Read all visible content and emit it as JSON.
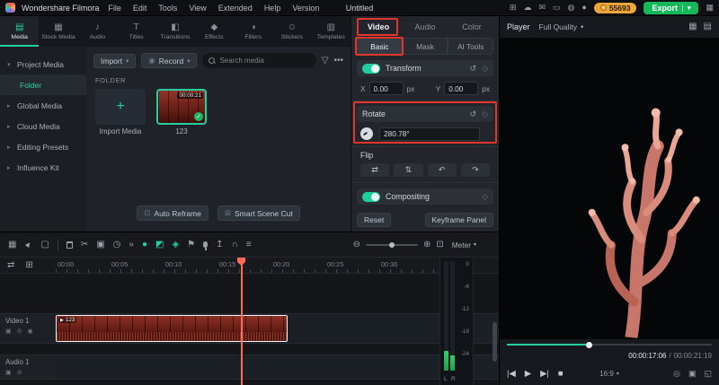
{
  "menubar": {
    "app_name": "Wondershare Filmora",
    "menus": [
      "File",
      "Edit",
      "Tools",
      "View",
      "Extended",
      "Help",
      "Version"
    ],
    "project_title": "Untitled",
    "credits": "55693",
    "export_label": "Export"
  },
  "media_tabs": {
    "labels": [
      "Media",
      "Stock Media",
      "Audio",
      "Titles",
      "Transitions",
      "Effects",
      "Filters",
      "Stickers",
      "Templates"
    ],
    "icons": [
      "▤",
      "▦",
      "♪",
      "T",
      "◧",
      "◆",
      "◑",
      "☺",
      "▥"
    ]
  },
  "sidebar": {
    "items": [
      "Project Media",
      "Folder",
      "Global Media",
      "Cloud Media",
      "Editing Presets",
      "Influence Kit"
    ]
  },
  "media_panel": {
    "import_label": "Import",
    "record_label": "Record",
    "search_placeholder": "Search media",
    "folder_heading": "FOLDER",
    "import_tile_label": "Import Media",
    "clip_name": "123",
    "clip_duration": "00:00:21",
    "auto_reframe_label": "Auto Reframe",
    "smart_scene_cut_label": "Smart Scene Cut"
  },
  "properties": {
    "tabs": [
      "Video",
      "Audio",
      "Color"
    ],
    "subtabs": [
      "Basic",
      "Mask",
      "AI Tools"
    ],
    "transform_label": "Transform",
    "x_label": "X",
    "x_value": "0.00",
    "x_unit": "px",
    "y_label": "Y",
    "y_value": "0.00",
    "y_unit": "px",
    "rotate_label": "Rotate",
    "rotate_value": "280.78°",
    "flip_label": "Flip",
    "compositing_label": "Compositing",
    "reset_label": "Reset",
    "keyframe_panel_label": "Keyframe Panel"
  },
  "player": {
    "label": "Player",
    "quality": "Full Quality",
    "current_time": "00:00:17:06",
    "time_separator": "/",
    "total_time": "00:00:21:19",
    "ratio": "16:9",
    "progress_percent": 40
  },
  "timeline": {
    "ruler": [
      "00:00",
      "00:05",
      "00:10",
      "00:15",
      "00:20",
      "00:25",
      "00:30"
    ],
    "video_track_name": "Video 1",
    "audio_track_name": "Audio 1",
    "clip_label": "123",
    "meter_label": "Meter",
    "meter_scale": [
      "0",
      "-6",
      "-12",
      "-18",
      "-24"
    ],
    "channel_left": "L",
    "channel_right": "R"
  },
  "colors": {
    "accent_teal": "#25cfa2",
    "export_green": "#17b85c",
    "annotation_red": "#e2352b",
    "playhead_orange": "#ff6a56",
    "badge_amber": "#eda53c"
  },
  "icons": {
    "caret_down": "▾",
    "chevron_right": "▸",
    "plugins": "⊞",
    "cloud": "☁",
    "feedback": "✉",
    "screen_recorder": "▭",
    "notification": "◍",
    "account": "●",
    "workspace": "▦",
    "record_dot": "◉",
    "filter": "▽",
    "more": "•••",
    "plus": "+",
    "check": "✓",
    "reset": "↺",
    "keyframe": "◇",
    "keyframe_nav": "◈",
    "flip_h": "⇄",
    "flip_v": "⇅",
    "rotate_ccw": "↶",
    "rotate_cw": "↷",
    "auto_reframe": "⊡",
    "scene_cut": "⊞",
    "layout_grid": "▦",
    "pointer": "▲",
    "box_select": "▢",
    "split": "✂",
    "crop": "▣",
    "speed": "◷",
    "more_tools": "»",
    "chroma": "●",
    "mask": "◩",
    "marker": "⚑",
    "render": "↥",
    "magnet": "∩",
    "snap": "≡",
    "zoom_out": "⊖",
    "zoom_in": "⊕",
    "fit": "⊡",
    "track_manage": "⇄",
    "track_add": "⊞",
    "lock": "▣",
    "mute": "⊘",
    "visibility": "◉",
    "prev_frame": "|◀",
    "play": "▶",
    "next_frame": "▶|",
    "stop": "■",
    "snapshot": "◎",
    "pip": "▣",
    "fullscreen": "◱",
    "grid_view": "▦",
    "single_view": "▤"
  }
}
